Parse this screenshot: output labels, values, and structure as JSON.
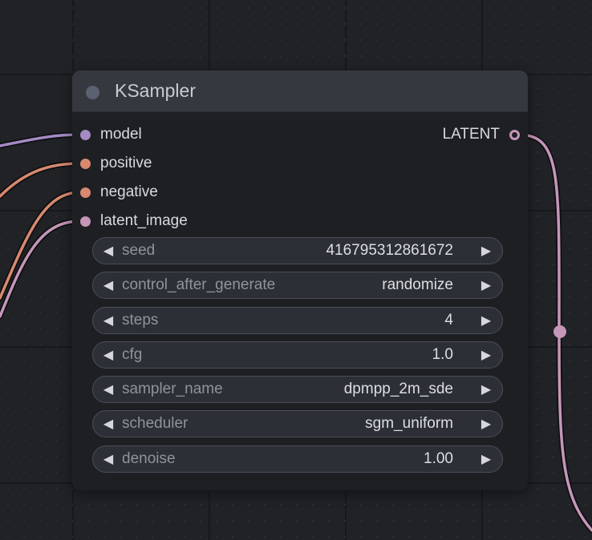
{
  "node": {
    "title": "KSampler",
    "inputs": [
      {
        "label": "model",
        "color": "#a48bc4"
      },
      {
        "label": "positive",
        "color": "#d9896f"
      },
      {
        "label": "negative",
        "color": "#d9896f"
      },
      {
        "label": "latent_image",
        "color": "#c596b8"
      }
    ],
    "output": {
      "label": "LATENT",
      "color": "#c596b8"
    },
    "widgets": [
      {
        "name": "seed",
        "value": "416795312861672"
      },
      {
        "name": "control_after_generate",
        "value": "randomize"
      },
      {
        "name": "steps",
        "value": "4"
      },
      {
        "name": "cfg",
        "value": "1.0"
      },
      {
        "name": "sampler_name",
        "value": "dpmpp_2m_sde"
      },
      {
        "name": "scheduler",
        "value": "sgm_uniform"
      },
      {
        "name": "denoise",
        "value": "1.00"
      }
    ],
    "arrow_left": "◀",
    "arrow_right": "▶"
  },
  "colors": {
    "canvas": "#202226",
    "node_body": "#1d1f23",
    "node_header": "#35383f",
    "wire_model": "#a48bc4",
    "wire_conditioning": "#d9896f",
    "wire_latent": "#c596b8"
  }
}
